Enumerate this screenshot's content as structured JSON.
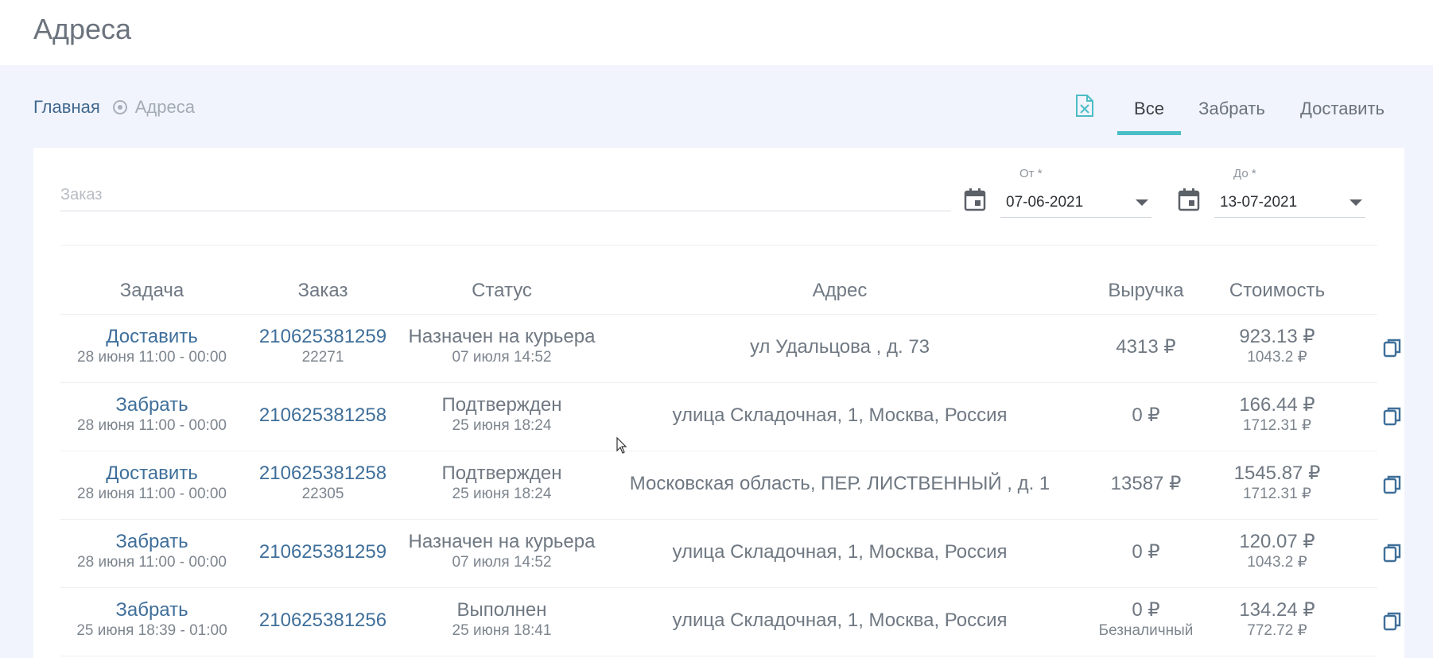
{
  "page": {
    "title": "Адреса"
  },
  "breadcrumb": {
    "home": "Главная",
    "current": "Адреса"
  },
  "tabs": [
    {
      "label": "Все",
      "active": true
    },
    {
      "label": "Забрать",
      "active": false
    },
    {
      "label": "Доставить",
      "active": false
    }
  ],
  "filters": {
    "order_placeholder": "Заказ",
    "from_label": "От *",
    "from_value": "07-06-2021",
    "to_label": "До *",
    "to_value": "13-07-2021"
  },
  "table": {
    "headers": [
      "Задача",
      "Заказ",
      "Статус",
      "Адрес",
      "Выручка",
      "Стоимость"
    ],
    "rows": [
      {
        "task": "Доставить",
        "time": "28 июня 11:00 - 00:00",
        "order": "210625381259",
        "order_sub": "22271",
        "status": "Назначен на курьера",
        "status_time": "07 июля 14:52",
        "address": "ул Удальцова , д. 73",
        "revenue": "4313 ₽",
        "revenue_sub": "",
        "cost": "923.13 ₽",
        "cost_sub": "1043.2 ₽"
      },
      {
        "task": "Забрать",
        "time": "28 июня 11:00 - 00:00",
        "order": "210625381258",
        "order_sub": "",
        "status": "Подтвержден",
        "status_time": "25 июня 18:24",
        "address": "улица Складочная, 1, Москва, Россия",
        "revenue": "0 ₽",
        "revenue_sub": "",
        "cost": "166.44 ₽",
        "cost_sub": "1712.31 ₽"
      },
      {
        "task": "Доставить",
        "time": "28 июня 11:00 - 00:00",
        "order": "210625381258",
        "order_sub": "22305",
        "status": "Подтвержден",
        "status_time": "25 июня 18:24",
        "address": "Московская область, ПЕР. ЛИСТВЕННЫЙ , д. 1",
        "revenue": "13587 ₽",
        "revenue_sub": "",
        "cost": "1545.87 ₽",
        "cost_sub": "1712.31 ₽"
      },
      {
        "task": "Забрать",
        "time": "28 июня 11:00 - 00:00",
        "order": "210625381259",
        "order_sub": "",
        "status": "Назначен на курьера",
        "status_time": "07 июля 14:52",
        "address": "улица Складочная, 1, Москва, Россия",
        "revenue": "0 ₽",
        "revenue_sub": "",
        "cost": "120.07 ₽",
        "cost_sub": "1043.2 ₽"
      },
      {
        "task": "Забрать",
        "time": "25 июня 18:39 - 01:00",
        "order": "210625381256",
        "order_sub": "",
        "status": "Выполнен",
        "status_time": "25 июня 18:41",
        "address": "улица Складочная, 1, Москва, Россия",
        "revenue": "0 ₽",
        "revenue_sub": "Безналичный",
        "cost": "134.24 ₽",
        "cost_sub": "772.72 ₽"
      }
    ]
  },
  "colors": {
    "accent": "#4bbdc6",
    "link": "#3f6f9a",
    "excel": "#4bbdc6"
  },
  "icons": {
    "excel": "excel-file-icon",
    "calendar": "calendar-icon",
    "copy": "copy-icon"
  }
}
